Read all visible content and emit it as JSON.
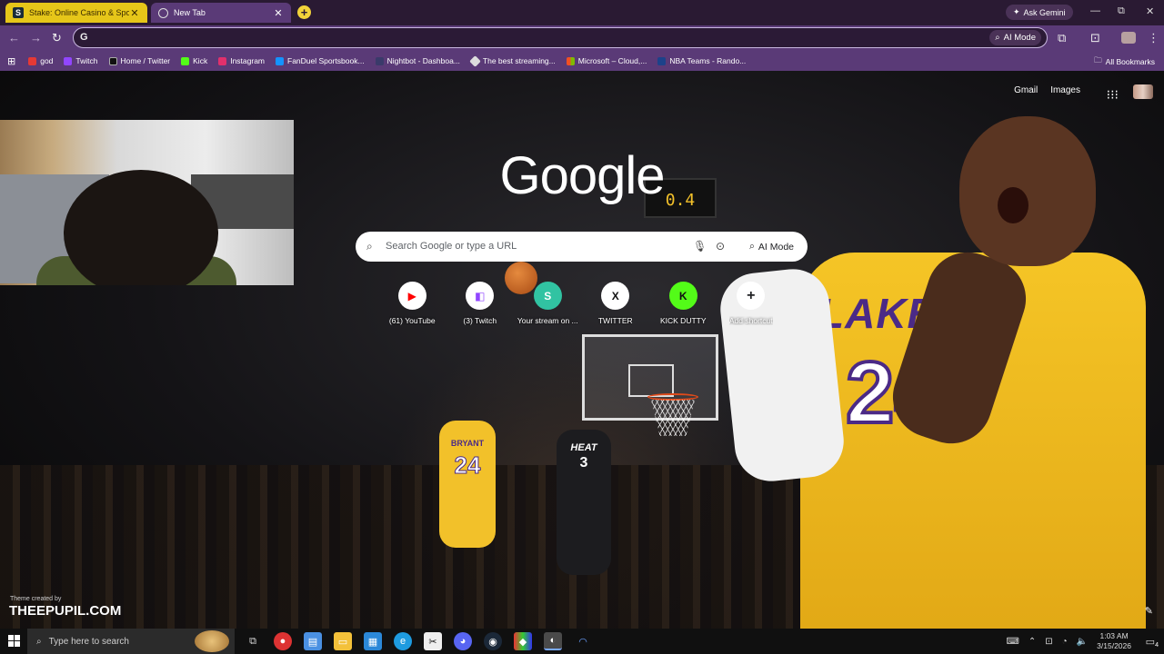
{
  "browser": {
    "tabs": [
      {
        "title": "Stake: Online Casino & Sports",
        "favicon": "stake-icon",
        "close": "✕"
      },
      {
        "title": "New Tab",
        "favicon": "chrome-icon",
        "close": "✕"
      }
    ],
    "new_tab": "+",
    "ask_gemini": "Ask Gemini",
    "window_controls": {
      "minimize": "—",
      "restore": "⧉",
      "close": "✕"
    },
    "omnibox": {
      "value": "",
      "ai_mode": "AI Mode"
    },
    "bookmarks": [
      {
        "label": "god",
        "color": "#e53935"
      },
      {
        "label": "Twitch",
        "color": "#9146ff"
      },
      {
        "label": "Home / Twitter",
        "color": "#111111"
      },
      {
        "label": "Kick",
        "color": "#53fc18"
      },
      {
        "label": "Instagram",
        "color": "#e1306c"
      },
      {
        "label": "FanDuel Sportsbook...",
        "color": "#1493ff"
      },
      {
        "label": "Nightbot - Dashboa...",
        "color": "#3a3a6a"
      },
      {
        "label": "The best streaming...",
        "color": "#dddddd"
      },
      {
        "label": "Microsoft – Cloud,...",
        "color": "#f25022"
      },
      {
        "label": "NBA Teams - Rando...",
        "color": "#1d428a"
      }
    ],
    "all_bookmarks": "All Bookmarks"
  },
  "ntp": {
    "logo": "Google",
    "links": {
      "gmail": "Gmail",
      "images": "Images"
    },
    "search_placeholder": "Search Google or type a URL",
    "ai_mode": "AI Mode",
    "shortcuts": [
      {
        "label": "(61) YouTube",
        "icon": "youtube-icon",
        "glyph": "▶",
        "color": "#ff0000"
      },
      {
        "label": "(3) Twitch",
        "icon": "twitch-icon",
        "glyph": "◧",
        "color": "#9146ff"
      },
      {
        "label": "Your stream on ...",
        "icon": "streamlabs-icon",
        "glyph": "S",
        "color": "#31c3a2"
      },
      {
        "label": "TWITTER",
        "icon": "x-icon",
        "glyph": "𝕏",
        "color": "#111111"
      },
      {
        "label": "KICK DUTTY",
        "icon": "kick-icon",
        "glyph": "K",
        "color": "#53fc18"
      },
      {
        "label": "Add shortcut",
        "icon": "plus-icon",
        "glyph": "+",
        "color": "#202124"
      }
    ],
    "theme_credit": "Theme created by",
    "theme_name": "THEEPUPIL.COM",
    "shot_clock": "0.4",
    "jersey_lakers": "LAKERS",
    "jersey_24": "24",
    "jersey_bryant": "BRYANT",
    "jersey_heat": "HEAT",
    "jersey_3": "3"
  },
  "taskbar": {
    "search_placeholder": "Type here to search",
    "time": "1:03 AM",
    "date": "3/15/2026",
    "notifications": "4"
  }
}
